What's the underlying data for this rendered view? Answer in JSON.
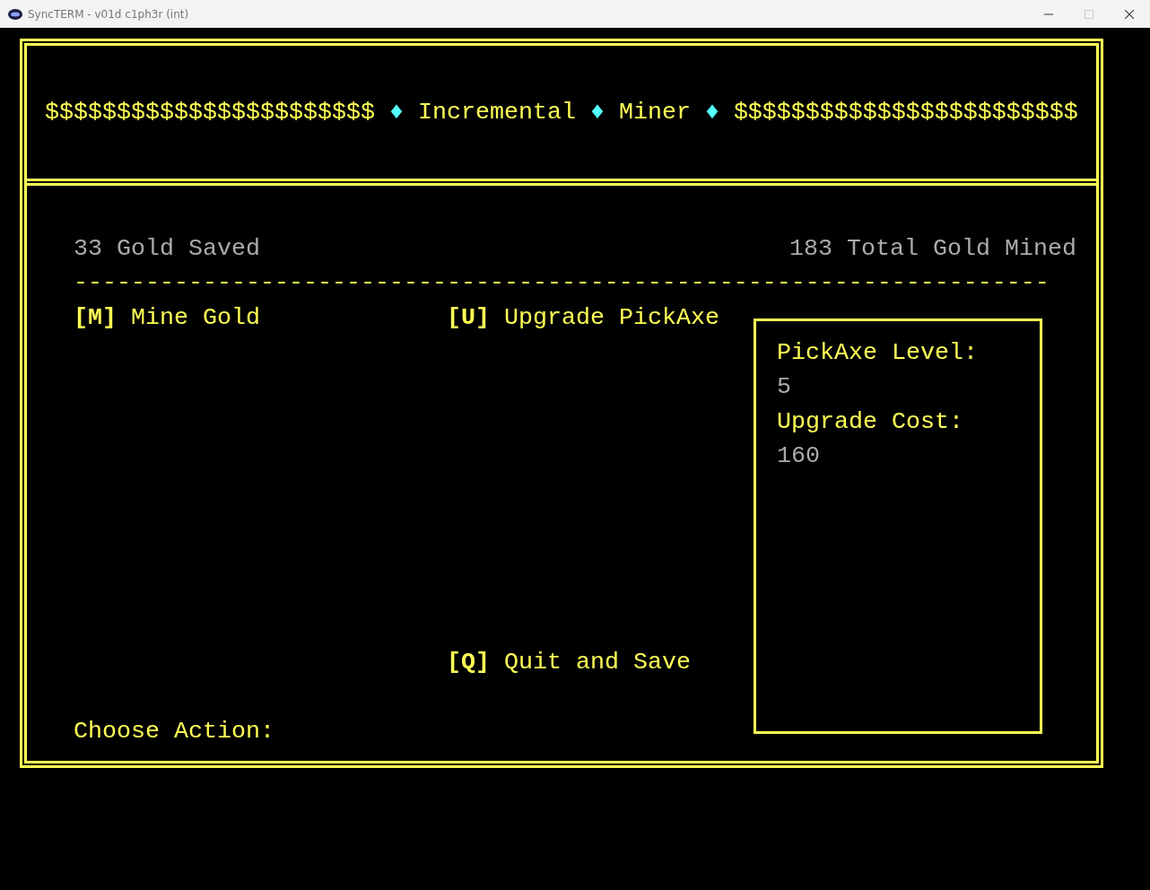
{
  "window": {
    "title": "SyncTERM - v01d c1ph3r (int)"
  },
  "banner": [
    {
      "kind": "dollars",
      "text": "$$$$$$$$$$$$$$$$$$$$$$$"
    },
    {
      "kind": "diamond",
      "text": "♦"
    },
    {
      "kind": "word",
      "text": "Incremental"
    },
    {
      "kind": "diamond",
      "text": "♦"
    },
    {
      "kind": "word",
      "text": "Miner"
    },
    {
      "kind": "diamond",
      "text": "♦"
    },
    {
      "kind": "dollars",
      "text": "$$$$$$$$$$$$$$$$$$$$$$$$"
    }
  ],
  "stats": {
    "gold_saved": "33 Gold Saved",
    "total_mined": "183 Total Gold Mined"
  },
  "divider": "--------------------------------------------------------------------",
  "actions": [
    {
      "key": "[M]",
      "label": "Mine Gold"
    },
    {
      "key": "[U]",
      "label": "Upgrade PickAxe"
    },
    {
      "key": "[Q]",
      "label": "Quit and Save"
    }
  ],
  "side_panel": [
    {
      "label": "PickAxe Level:",
      "value": "5"
    },
    {
      "label": "Upgrade Cost:",
      "value": "160"
    }
  ],
  "prompt": "Choose Action:"
}
